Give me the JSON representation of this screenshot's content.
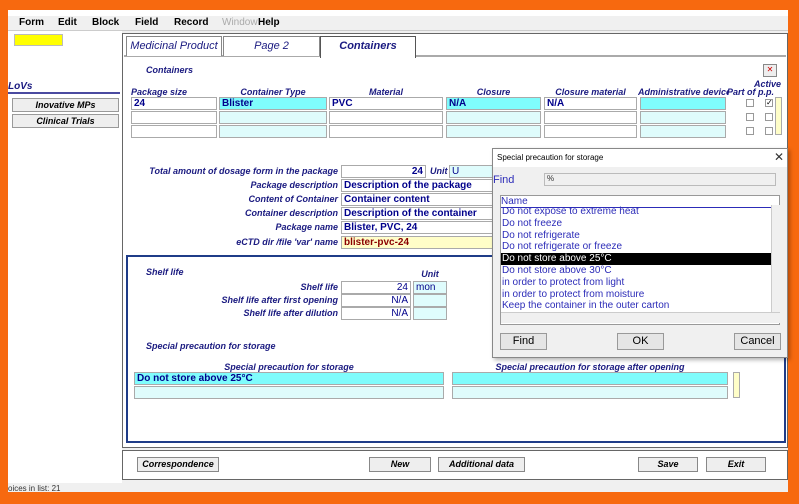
{
  "menu": [
    "Form",
    "Edit",
    "Block",
    "Field",
    "Record",
    "Window",
    "Help"
  ],
  "left": {
    "lovs": "LoVs",
    "buttons": [
      "Inovative MPs",
      "Clinical Trials"
    ]
  },
  "tabs": [
    "Medicinal Product",
    "Page 2",
    "Containers"
  ],
  "containers": {
    "title": "Containers",
    "columns": [
      "Package size",
      "Container Type",
      "Material",
      "Closure",
      "Closure material",
      "Administrative device",
      "Part of p.p.",
      "Active"
    ],
    "rows": [
      {
        "package_size": "24",
        "container_type": "Blister",
        "material": "PVC",
        "closure": "N/A",
        "closure_material": "N/A",
        "admin_device": "",
        "part_of": false,
        "active": true
      },
      {
        "package_size": "",
        "container_type": "",
        "material": "",
        "closure": "",
        "closure_material": "",
        "admin_device": "",
        "part_of": false,
        "active": false
      },
      {
        "package_size": "",
        "container_type": "",
        "material": "",
        "closure": "",
        "closure_material": "",
        "admin_device": "",
        "part_of": false,
        "active": false
      }
    ]
  },
  "details": {
    "total_label": "Total amount of dosage form in the package",
    "total_value": "24",
    "unit_label": "Unit",
    "unit_value": "U",
    "pkg_desc_label": "Package description",
    "pkg_desc": "Description of the package",
    "content_label": "Content of Container",
    "content": "Container content",
    "cont_desc_label": "Container description",
    "cont_desc": "Description of the container",
    "pkg_name_label": "Package name",
    "pkg_name": "Blister, PVC, 24",
    "ectd_label": "eCTD dir /file 'var' name",
    "ectd": "blister-pvc-24"
  },
  "shelf": {
    "title": "Shelf life",
    "unit_header": "Unit",
    "rows": [
      {
        "label": "Shelf life",
        "value": "24",
        "unit": "mon"
      },
      {
        "label": "Shelf life after first opening",
        "value": "N/A",
        "unit": ""
      },
      {
        "label": "Shelf life after dilution",
        "value": "N/A",
        "unit": ""
      }
    ]
  },
  "storage": {
    "title": "Special precaution for storage",
    "col1": "Special precaution for storage",
    "col2": "Special precaution for storage after opening",
    "value1": "Do not store above 25°C",
    "value2": ""
  },
  "dialog": {
    "title": "Special precaution for storage",
    "find_label": "Find",
    "find_value": "%",
    "list_header": "Name",
    "items": [
      "Do not expose to extreme heat",
      "Do not freeze",
      "Do not refrigerate",
      "Do not refrigerate or freeze",
      "Do not store above 25°C",
      "Do not store above 30°C",
      "in order to protect from light",
      "in order to protect from moisture",
      "Keep the container in the outer carton"
    ],
    "selected_index": 4,
    "buttons": {
      "find": "Find",
      "ok": "OK",
      "cancel": "Cancel"
    }
  },
  "bottom": {
    "correspondence": "Correspondence",
    "new": "New",
    "additional": "Additional data",
    "save": "Save",
    "exit": "Exit"
  },
  "status": "oices in list: 21"
}
